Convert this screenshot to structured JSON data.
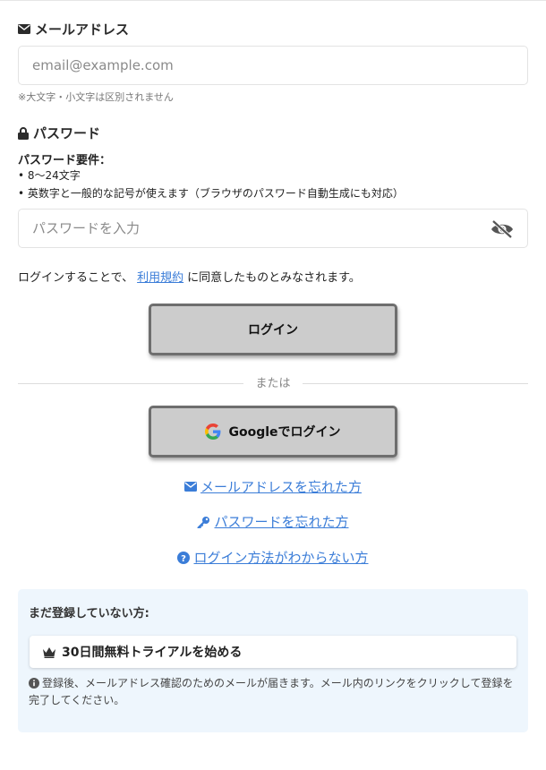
{
  "colors": {
    "link": "#3b7dd8",
    "button_bg": "#cccccc",
    "button_border": "#6e6e6e",
    "panel_bg": "#eef6fd"
  },
  "email": {
    "label": "メールアドレス",
    "icon": "envelope-icon",
    "placeholder": "email@example.com",
    "value": "",
    "note": "※大文字・小文字は区別されません"
  },
  "password": {
    "label": "パスワード",
    "icon": "lock-icon",
    "requirements_title": "パスワード要件：",
    "requirements": [
      "• 8〜24文字",
      "• 英数字と一般的な記号が使えます（ブラウザのパスワード自動生成にも対応）"
    ],
    "placeholder": "パスワードを入力",
    "value": "",
    "toggle_icon": "eye-slash-icon"
  },
  "terms": {
    "before": "ログインすることで、",
    "link": "利用規約",
    "after": "に同意したものとみなされます。"
  },
  "login_button": {
    "label": "ログイン"
  },
  "divider": {
    "text": "または"
  },
  "google_button": {
    "label": "Googleでログイン",
    "icon": "google-icon"
  },
  "help_links": [
    {
      "label": "メールアドレスを忘れた方",
      "icon": "envelope-icon"
    },
    {
      "label": "パスワードを忘れた方",
      "icon": "key-icon"
    },
    {
      "label": "ログイン方法がわからない方",
      "icon": "question-circle-icon"
    }
  ],
  "signup": {
    "title": "まだ登録していない方:",
    "trial_label": "30日間無料トライアルを始める",
    "trial_icon": "crown-icon",
    "info": "登録後、メールアドレス確認のためのメールが届きます。メール内のリンクをクリックして登録を完了してください。",
    "info_icon": "info-circle-icon"
  }
}
